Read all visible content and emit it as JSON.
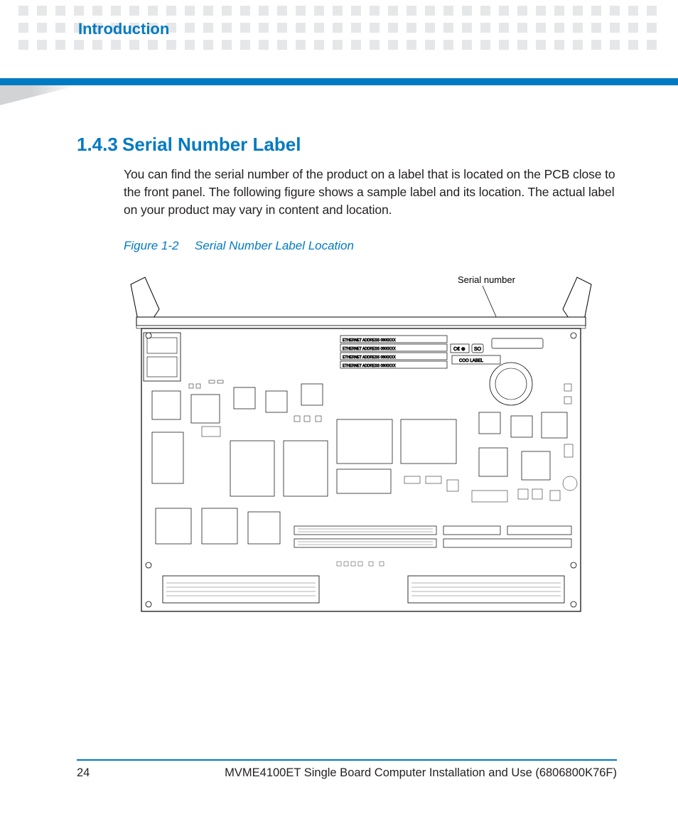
{
  "header": {
    "chapter_title": "Introduction"
  },
  "section": {
    "number": "1.4.3",
    "title": "Serial Number Label",
    "body": "You can find the serial number of the product on a label that is located on the PCB close to the front panel. The following figure shows a sample label and its location. The actual label on your product may vary in content and location."
  },
  "figure": {
    "label": "Figure 1-2",
    "caption": "Serial Number Label Location",
    "callout": "Serial number",
    "board_labels": {
      "ethernet_rows": "ETHERNET ADDRESS 0800XXX",
      "ce_mark": "CE",
      "so_mark": "SO",
      "coo": "COO LABEL"
    }
  },
  "footer": {
    "page": "24",
    "doc_title": "MVME4100ET Single Board Computer Installation and Use (6806800K76F)"
  }
}
